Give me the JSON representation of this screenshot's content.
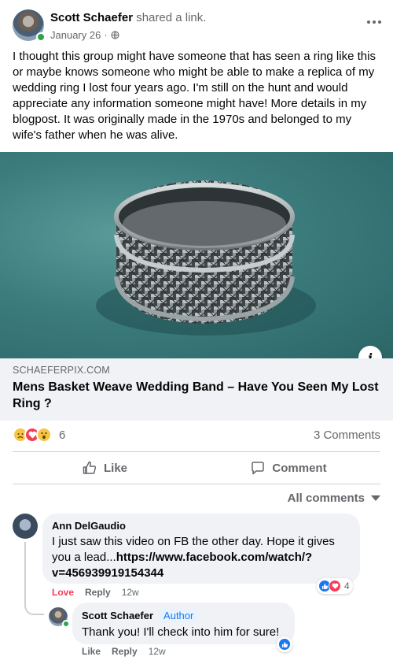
{
  "post": {
    "author": "Scott Schaefer",
    "action": "shared a link.",
    "date": "January 26",
    "date_separator": "·",
    "body": "I thought this group might have someone that has seen a ring like this or maybe knows someone who might be able to make a replica of my wedding ring I lost four years ago. I'm still on the hunt and would appreciate any information someone might have! More details in my blogpost. It was originally made in the 1970s and belonged to my wife's father when he was alive."
  },
  "link": {
    "domain": "SCHAEFERPIX.COM",
    "title": "Mens Basket Weave Wedding Band – Have You Seen My Lost Ring ?",
    "info_label": "i"
  },
  "reactions": {
    "count": "6",
    "comments": "3 Comments"
  },
  "actions": {
    "like": "Like",
    "comment": "Comment"
  },
  "comments_filter": "All comments",
  "comments": [
    {
      "name": "Ann DelGaudio",
      "text": "I just saw this video on FB the other day. Hope it gives you a lead...",
      "link": "https://www.facebook.com/watch/?v=456939919154344",
      "reaction_label": "Love",
      "reply": "Reply",
      "time": "12w",
      "reaction_count": "4"
    },
    {
      "name": "Scott Schaefer",
      "badge": "Author",
      "text": "Thank you! I'll check into him for sure!",
      "like": "Like",
      "reply": "Reply",
      "time": "12w"
    }
  ],
  "colors": {
    "accent": "#1877f2",
    "love": "#f33e58",
    "online": "#31a24c",
    "muted": "#65676b"
  }
}
